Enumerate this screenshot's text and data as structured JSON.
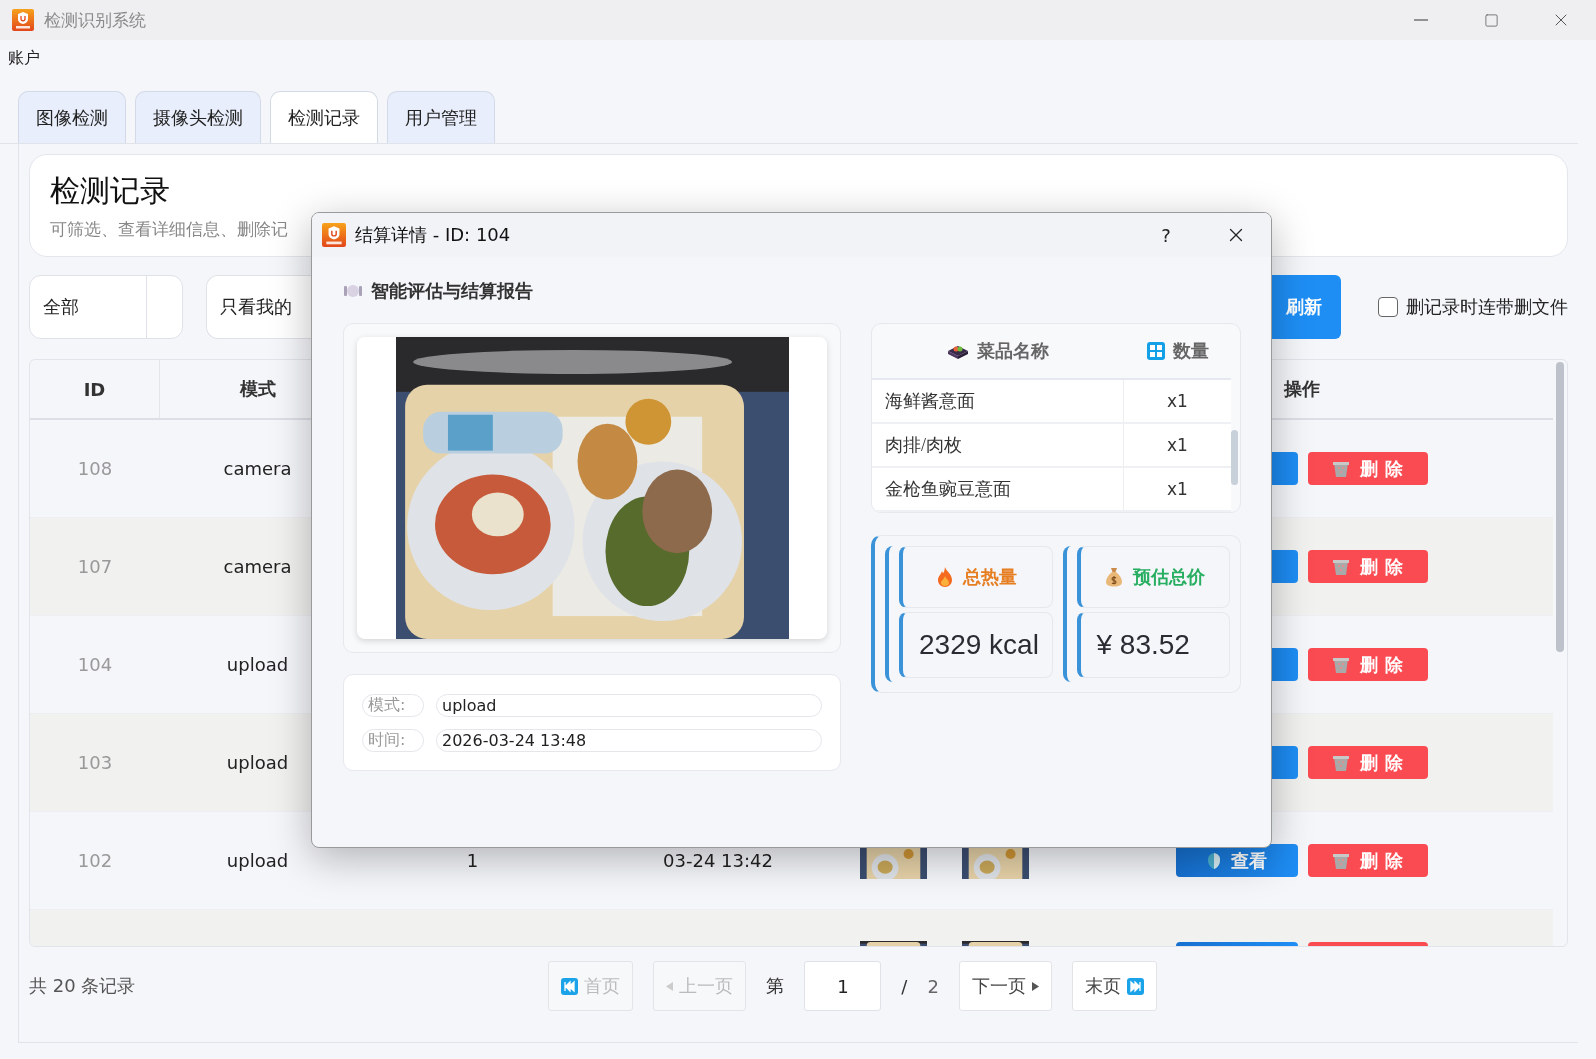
{
  "window": {
    "title": "检测识别系统"
  },
  "menu": [
    "账户"
  ],
  "tabs": [
    {
      "label": "图像检测",
      "selected": false
    },
    {
      "label": "摄像头检测",
      "selected": false
    },
    {
      "label": "检测记录",
      "selected": true
    },
    {
      "label": "用户管理",
      "selected": false
    }
  ],
  "header": {
    "title": "检测记录",
    "subtitle": "可筛选、查看详细信息、删除记"
  },
  "filters": {
    "scope": "全部",
    "mine": "只看我的",
    "refresh": "刷新",
    "delete_files": {
      "label": "删记录时连带删文件",
      "checked": false
    }
  },
  "table": {
    "columns": [
      "ID",
      "模式",
      "操作"
    ],
    "rows": [
      {
        "id": "108",
        "mode": "camera",
        "actions": [
          {
            "kind": "view"
          },
          {
            "kind": "delete",
            "label": "删 除"
          }
        ]
      },
      {
        "id": "107",
        "mode": "camera",
        "actions": [
          {
            "kind": "view"
          },
          {
            "kind": "delete",
            "label": "删 除"
          }
        ]
      },
      {
        "id": "104",
        "mode": "upload",
        "actions": [
          {
            "kind": "view"
          },
          {
            "kind": "delete",
            "label": "删 除"
          }
        ]
      },
      {
        "id": "103",
        "mode": "upload",
        "actions": [
          {
            "kind": "view"
          },
          {
            "kind": "delete",
            "label": "删 除"
          }
        ]
      },
      {
        "id": "102",
        "mode": "upload",
        "column_3": "1",
        "column_4": "03-24 13:42",
        "thumbnails": [
          {
            "kind": "picture"
          },
          {
            "kind": "picture"
          }
        ],
        "actions": [
          {
            "kind": "view",
            "label": "查看"
          },
          {
            "kind": "delete",
            "label": "删 除"
          }
        ]
      },
      {
        "thumbnails": [
          {
            "kind": "picture"
          },
          {
            "kind": "picture"
          }
        ],
        "actions": [
          {
            "kind": "view"
          },
          {
            "kind": "delete"
          }
        ]
      }
    ]
  },
  "footer": {
    "total": "共 20 条记录",
    "pager": {
      "first": {
        "label": "首页",
        "disabled": true
      },
      "prev": {
        "label": "上一页",
        "disabled": true
      },
      "page_prefix": "第",
      "page": "1",
      "separator": "/",
      "pages": "2",
      "next": {
        "label": "下一页",
        "disabled": false
      },
      "last": {
        "label": "末页",
        "disabled": false
      }
    }
  },
  "dialog": {
    "title": "结算详情 - ID: 104",
    "help": "?",
    "heading": "智能评估与结算报告",
    "image": {
      "kind": "picture"
    },
    "info": [
      {
        "label": "模式:",
        "value": "upload"
      },
      {
        "label": "时间:",
        "value": "2026-03-24 13:48"
      }
    ],
    "dishes": {
      "columns": [
        "菜品名称",
        "数量"
      ],
      "rows": [
        {
          "name": "海鲜酱意面",
          "count": "x1"
        },
        {
          "name": "肉排/肉枚",
          "count": "x1"
        },
        {
          "name": "金枪鱼豌豆意面",
          "count": "x1"
        }
      ]
    },
    "stats": [
      {
        "kind": "calories",
        "label": "总热量",
        "value": "2329 kcal",
        "color": "#e67e22"
      },
      {
        "kind": "price",
        "label": "预估总价",
        "value": "¥ 83.52",
        "color": "#27ae60"
      }
    ]
  }
}
